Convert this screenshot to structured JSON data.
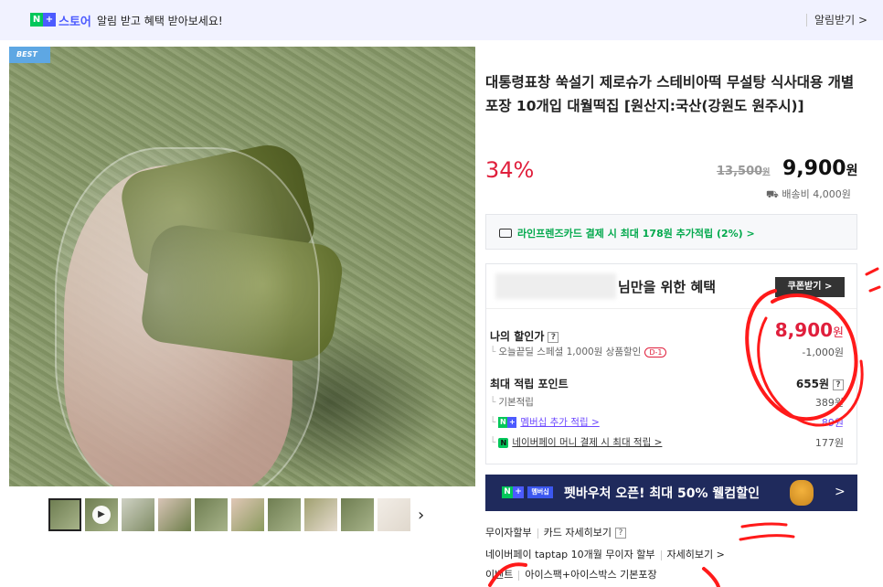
{
  "topbar": {
    "badge_n": "N",
    "badge_plus": "+",
    "store_label": "스토어",
    "message": "알림 받고 혜택 받아보세요!",
    "alarm_button": "알림받기 >"
  },
  "gallery": {
    "best_badge": "BEST",
    "thumbnail_count": 10,
    "next_icon": "chevron-right-icon"
  },
  "product": {
    "title": "대통령표창 쑥설기 제로슈가 스테비아떡 무설탕 식사대용 개별포장 10개입 대월떡집 [원산지:국산(강원도 원주시)]",
    "discount_rate": "34%",
    "original_price": "13,500",
    "original_unit": "원",
    "price": "9,900",
    "price_unit": "원",
    "shipping": "배송비 4,000원"
  },
  "card_promo": {
    "text": "라인프렌즈카드 결제 시 최대 178원 추가적립 (2%) >"
  },
  "benefit": {
    "title": "님만을 위한 혜택",
    "coupon_button": "쿠폰받기 >",
    "my_discount_label": "나의 할인가",
    "my_discount_price": "8,900",
    "my_discount_unit": "원",
    "today_deal": "오늘끝딜 스페셜 1,000원 상품할인",
    "d_tag": "D-1",
    "today_deal_value": "-1,000원",
    "points_label": "최대 적립 포인트",
    "points_value": "655원",
    "base_points_label": "기본적립",
    "base_points_value": "389원",
    "membership_label": "멤버십 추가 적립 >",
    "membership_value": "89원",
    "naverpay_label": "네이버페이 머니 결제 시 최대 적립 >",
    "naverpay_value": "177원",
    "help_mark": "?"
  },
  "banner": {
    "badge_n": "N",
    "badge_plus": "+",
    "badge_member": "멤버십",
    "text": "펫바우처 오픈! 최대 50% 웰컴할인",
    "next": ">"
  },
  "payment": {
    "installment": "무이자할부",
    "card_detail": "카드 자세히보기",
    "help_mark": "?",
    "taptap": "네이버페이 taptap 10개월 무이자 할부",
    "taptap_detail": "자세히보기 >",
    "gift_label": "이벤트",
    "gift_text": "아이스팩+아이스박스 기본포장"
  },
  "colors": {
    "accent_red": "#e01f3c",
    "naver_green": "#03c75a",
    "plus_purple": "#4c5bff",
    "banner_navy": "#1f2a5c"
  }
}
